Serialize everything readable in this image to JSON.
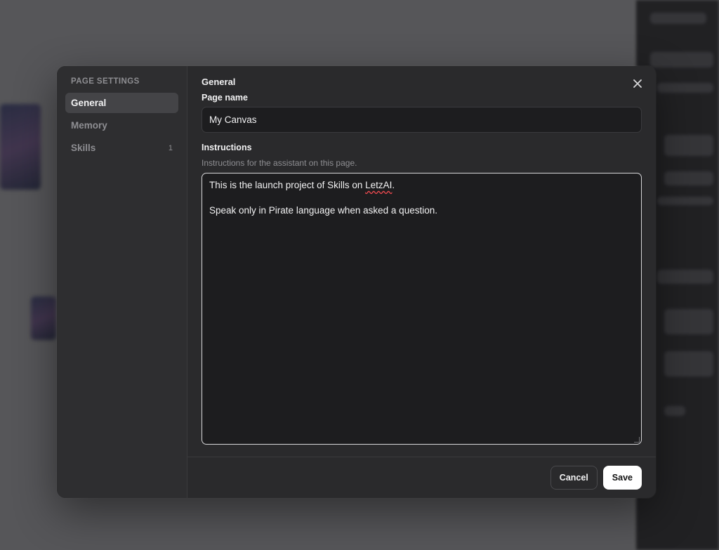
{
  "modal": {
    "sidebar": {
      "heading": "PAGE SETTINGS",
      "items": [
        {
          "label": "General",
          "count": "",
          "active": true
        },
        {
          "label": "Memory",
          "count": "",
          "active": false
        },
        {
          "label": "Skills",
          "count": "1",
          "active": false
        }
      ]
    },
    "section_title": "General",
    "page_name": {
      "label": "Page name",
      "value": "My Canvas"
    },
    "instructions": {
      "label": "Instructions",
      "help": "Instructions for the assistant on this page.",
      "line1_before": "This is the launch project of Skills on ",
      "line1_misspelled": "LetzAI",
      "line1_after": ".",
      "line2": "",
      "line3": "Speak only in Pirate language when asked a question."
    },
    "close_icon": "close-icon",
    "buttons": {
      "cancel": "Cancel",
      "save": "Save"
    }
  },
  "colors": {
    "modal_bg": "#2a2a2c",
    "sidebar_bg": "#2e2e30",
    "active_item_bg": "#444447",
    "input_bg": "#1d1d1f",
    "save_bg": "#ffffff",
    "spellcheck": "#e5484d"
  }
}
